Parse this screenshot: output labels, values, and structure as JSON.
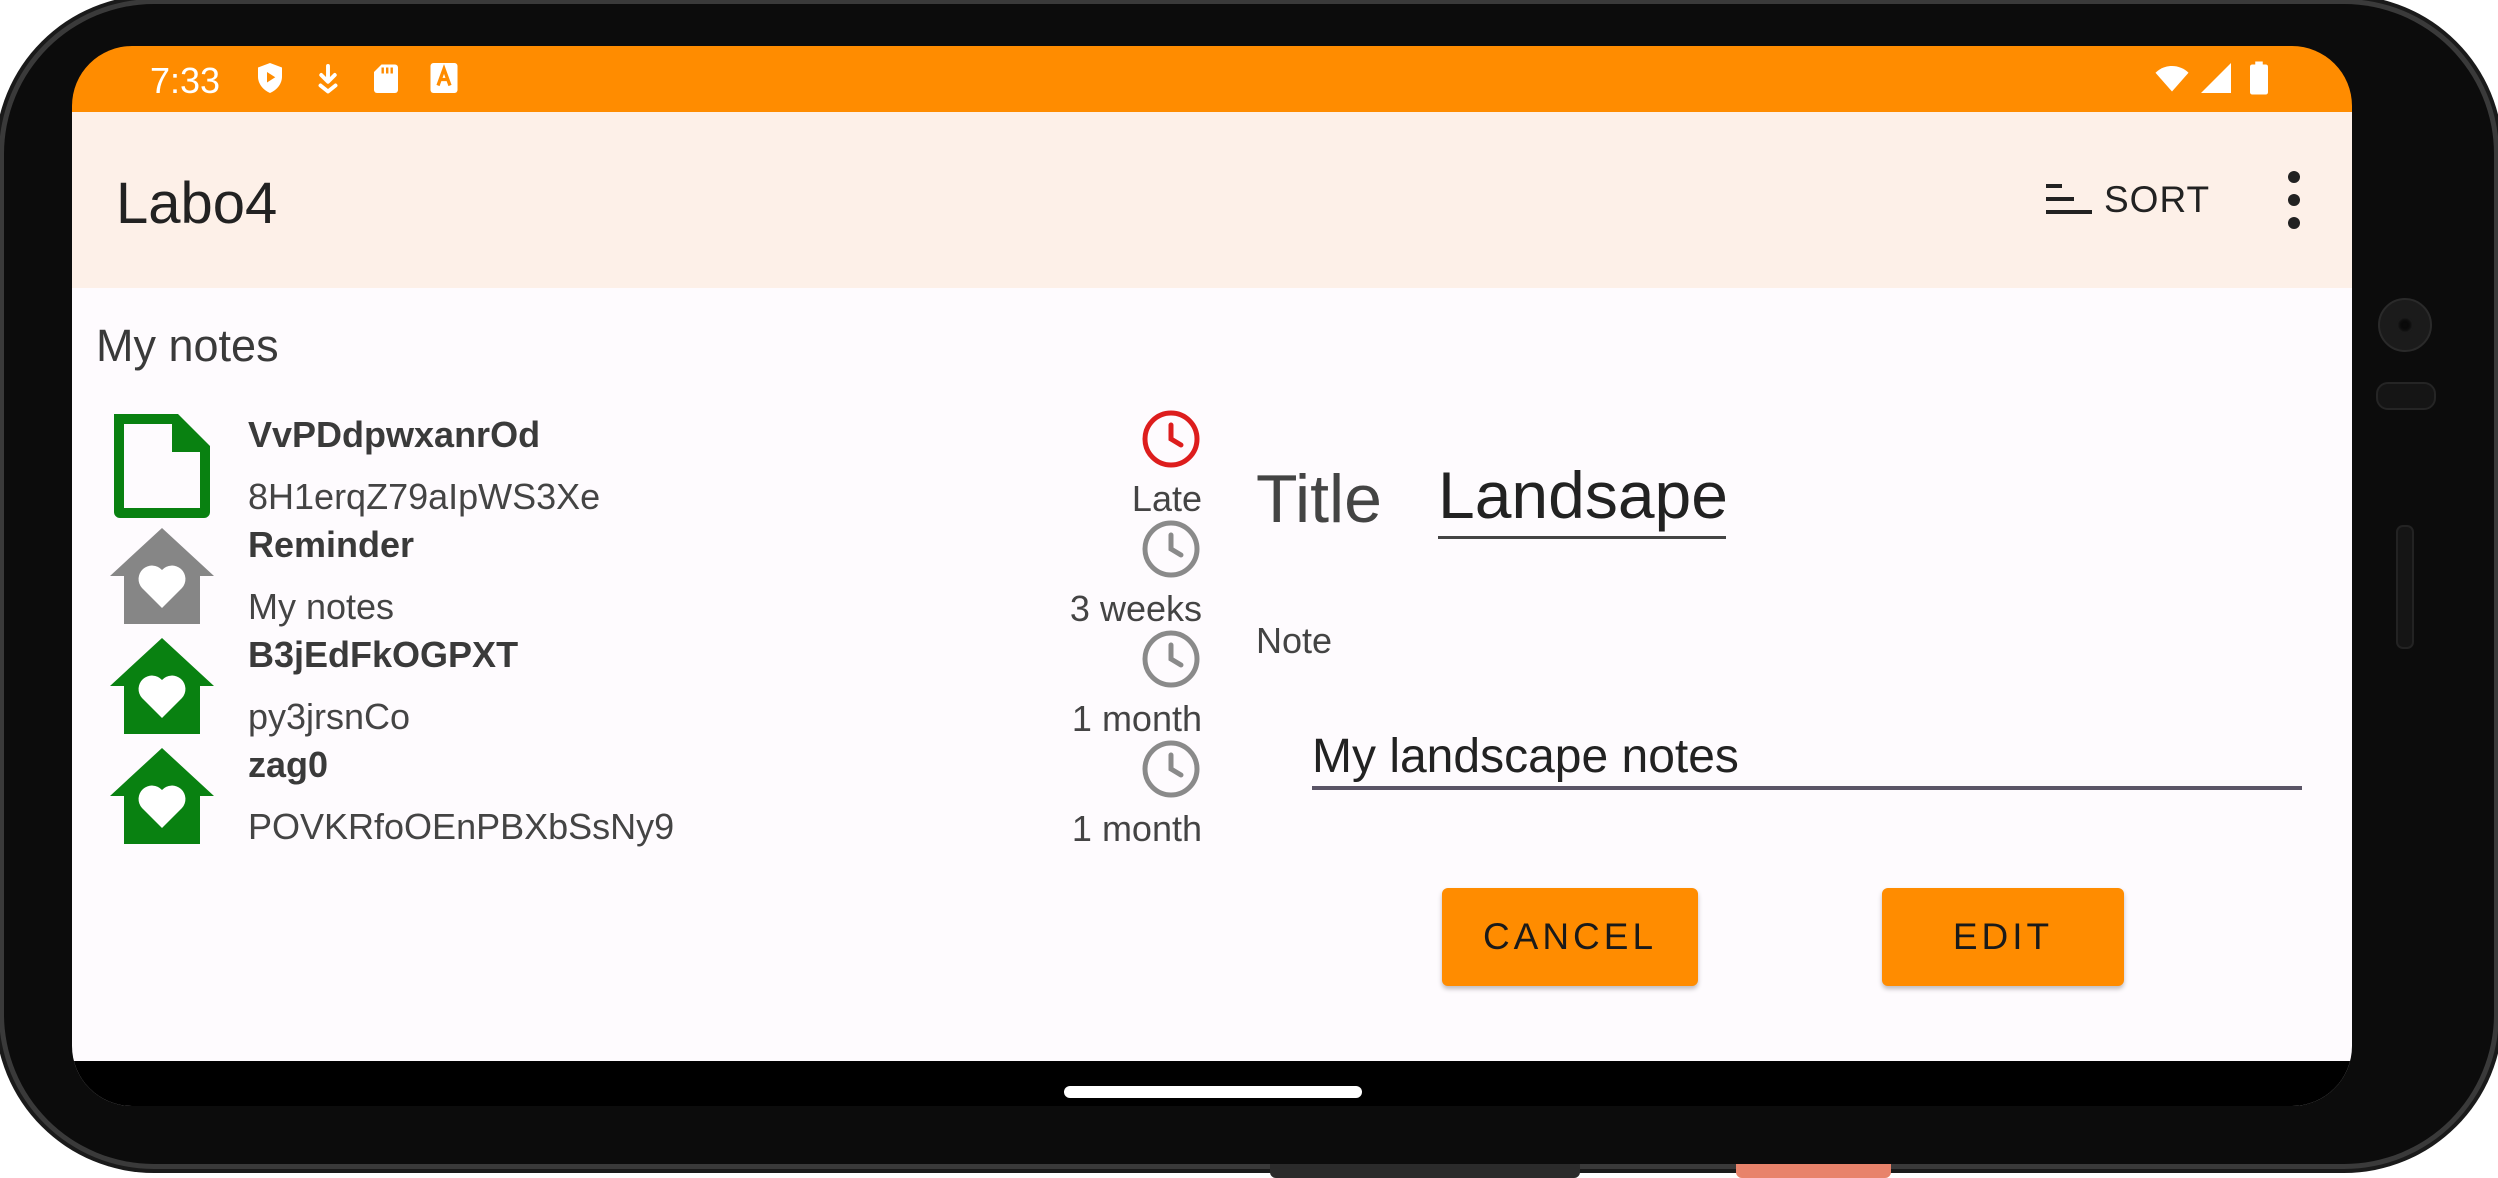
{
  "status_bar": {
    "time": "7:33",
    "icons_left": [
      "play-protect-icon",
      "download-icon",
      "sd-card-icon",
      "keyboard-icon"
    ],
    "icons_right": [
      "wifi-icon",
      "cell-signal-icon",
      "battery-icon"
    ],
    "color": "#ff8c00"
  },
  "app_bar": {
    "title": "Labo4",
    "sort_label": "SORT",
    "sort_icon": "sort-icon",
    "menu_icon": "more-vert-icon",
    "background": "#fdf0e8"
  },
  "list": {
    "section_title": "My notes",
    "items": [
      {
        "title": "VvPDdpwxanrOd",
        "subtitle": "8H1erqZ79aIpWS3Xe",
        "time": "Late",
        "icon": "document-icon",
        "icon_color": "#098111",
        "clock_color": "#dd1d1d"
      },
      {
        "title": "Reminder",
        "subtitle": "My notes",
        "time": "3 weeks",
        "icon": "home-heart-icon",
        "icon_color": "#868686",
        "clock_color": "#8a8a8a"
      },
      {
        "title": "B3jEdFkOGPXT",
        "subtitle": "py3jrsnCo",
        "time": "1 month",
        "icon": "home-heart-icon",
        "icon_color": "#098111",
        "clock_color": "#8a8a8a"
      },
      {
        "title": "zag0",
        "subtitle": "POVKRfoOEnPBXbSsNy9",
        "time": "1 month",
        "icon": "home-heart-icon",
        "icon_color": "#098111",
        "clock_color": "#8a8a8a"
      }
    ]
  },
  "detail": {
    "title_label": "Title",
    "title_value": "Landsape",
    "note_label": "Note",
    "note_value": "My landscape notes",
    "cancel_label": "CANCEL",
    "edit_label": "EDIT",
    "accent": "#ff8c00"
  }
}
